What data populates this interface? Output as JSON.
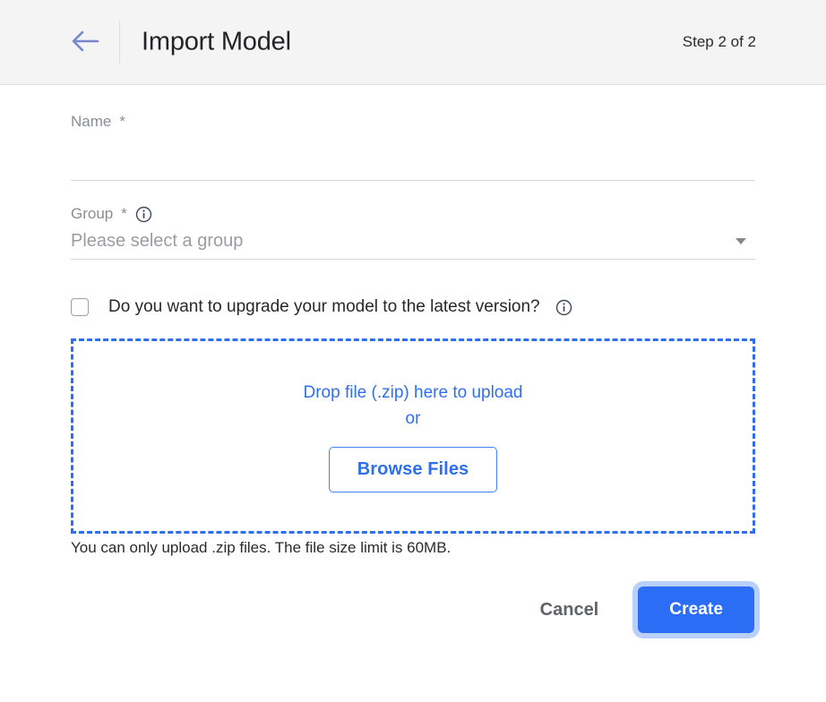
{
  "header": {
    "back_icon": "arrow-left-icon",
    "title": "Import Model",
    "step": "Step 2 of 2"
  },
  "form": {
    "name_field": {
      "label": "Name",
      "required_marker": "*",
      "value": "",
      "placeholder": ""
    },
    "group_field": {
      "label": "Group",
      "required_marker": "*",
      "info_icon": "info-icon",
      "selected": "Please select a group",
      "arrow_icon": "chevron-down-icon"
    },
    "upgrade_checkbox": {
      "label": "Do you want to upgrade your model to the latest version?",
      "checked": false,
      "info_icon": "info-icon"
    },
    "dropzone": {
      "drop_text": "Drop file (.zip) here to upload",
      "or_text": "or",
      "browse_label": "Browse Files"
    },
    "hint": "You can only upload .zip files. The file size limit is 60MB."
  },
  "actions": {
    "cancel_label": "Cancel",
    "create_label": "Create"
  },
  "colors": {
    "accent_blue": "#2f6fef",
    "create_button": "#2b6ef5",
    "focus_ring": "#b9d0fb",
    "back_arrow": "#7986cb",
    "header_bg": "#f4f4f5",
    "label_gray": "#8a8d91",
    "info_icon": "#3f4a5a"
  }
}
